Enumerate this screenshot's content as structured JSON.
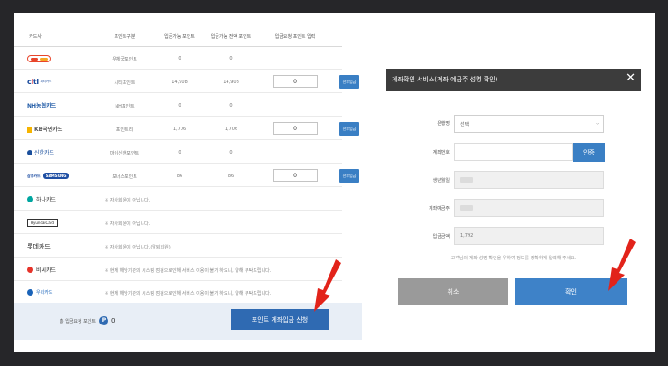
{
  "table": {
    "headers": [
      "카드사",
      "포인트구분",
      "입금가능 포인트",
      "입금가능 전액 포인트",
      "입금요청 포인트 입력"
    ],
    "rows": [
      {
        "logo": "hyundaimc",
        "name": "우체국포인트",
        "points": "0",
        "full": "0",
        "qty": "",
        "button": ""
      },
      {
        "logo": "citi",
        "logo_text": "citi",
        "logo_sub": "씨티카드",
        "name": "시티포인트",
        "points": "14,908",
        "full": "14,908",
        "qty": "0",
        "button": "전부입금"
      },
      {
        "logo": "nh",
        "logo_text": "NH농협카드",
        "name": "NH포인트",
        "points": "0",
        "full": "0",
        "qty": "",
        "button": ""
      },
      {
        "logo": "kb",
        "logo_text": "KB국민카드",
        "name": "포인트리",
        "points": "1,706",
        "full": "1,706",
        "qty": "0",
        "button": "전부입금"
      },
      {
        "logo": "shinhan",
        "logo_text": "신한카드",
        "name": "마이신한포인트",
        "points": "0",
        "full": "0",
        "qty": "",
        "button": ""
      },
      {
        "logo": "samsung",
        "logo_text": "SAMSUNG",
        "logo_sub": "삼성카드",
        "name": "보너스포인트",
        "points": "86",
        "full": "86",
        "qty": "0",
        "button": "전부입금"
      },
      {
        "logo": "hana",
        "logo_text": "하나카드",
        "note": "※ 자사회원이 아닙니다."
      },
      {
        "logo": "hyundai",
        "logo_text": "HyundaiCard",
        "note": "※ 자사회원이 아닙니다."
      },
      {
        "logo": "lotte",
        "logo_text": "롯데카드",
        "note": "※ 자사회원이 아닙니다.(탈퇴회원)"
      },
      {
        "logo": "bc",
        "logo_text": "비씨카드",
        "note": "※ 현재 해당기관의 시스템 점검으로인해 서비스 이용이 불가 하오니, 양해 부탁드립니다."
      },
      {
        "logo": "woori",
        "logo_text": "우리카드",
        "note": "※ 현재 해당기관의 시스템 점검으로인해 서비스 이용이 불가 하오니, 양해 부탁드립니다."
      }
    ]
  },
  "summary": {
    "total_label": "총 입금요청 포인트",
    "point_symbol": "P",
    "total_value": "0",
    "apply_label": "포인트 계좌입금 신청"
  },
  "modal": {
    "title": "계좌확인 서비스(계좌 예금주 성명 확인)",
    "close": "✕",
    "bank_label": "은행명",
    "bank_value": "선택",
    "account_label": "계좌번호",
    "verify_label": "인증",
    "birth_label": "생년월일",
    "holder_label": "계좌예금주",
    "amount_label": "입금금액",
    "amount_value": "1,792",
    "notice": "고객님의 계좌-성명 확인을 위하여 정보를 정확하게 입력해 주세요.",
    "cancel_label": "취소",
    "confirm_label": "확인"
  },
  "colors": {
    "accent": "#3a7fc4",
    "header": "#3c3c3c",
    "arrow": "#e2231a"
  }
}
